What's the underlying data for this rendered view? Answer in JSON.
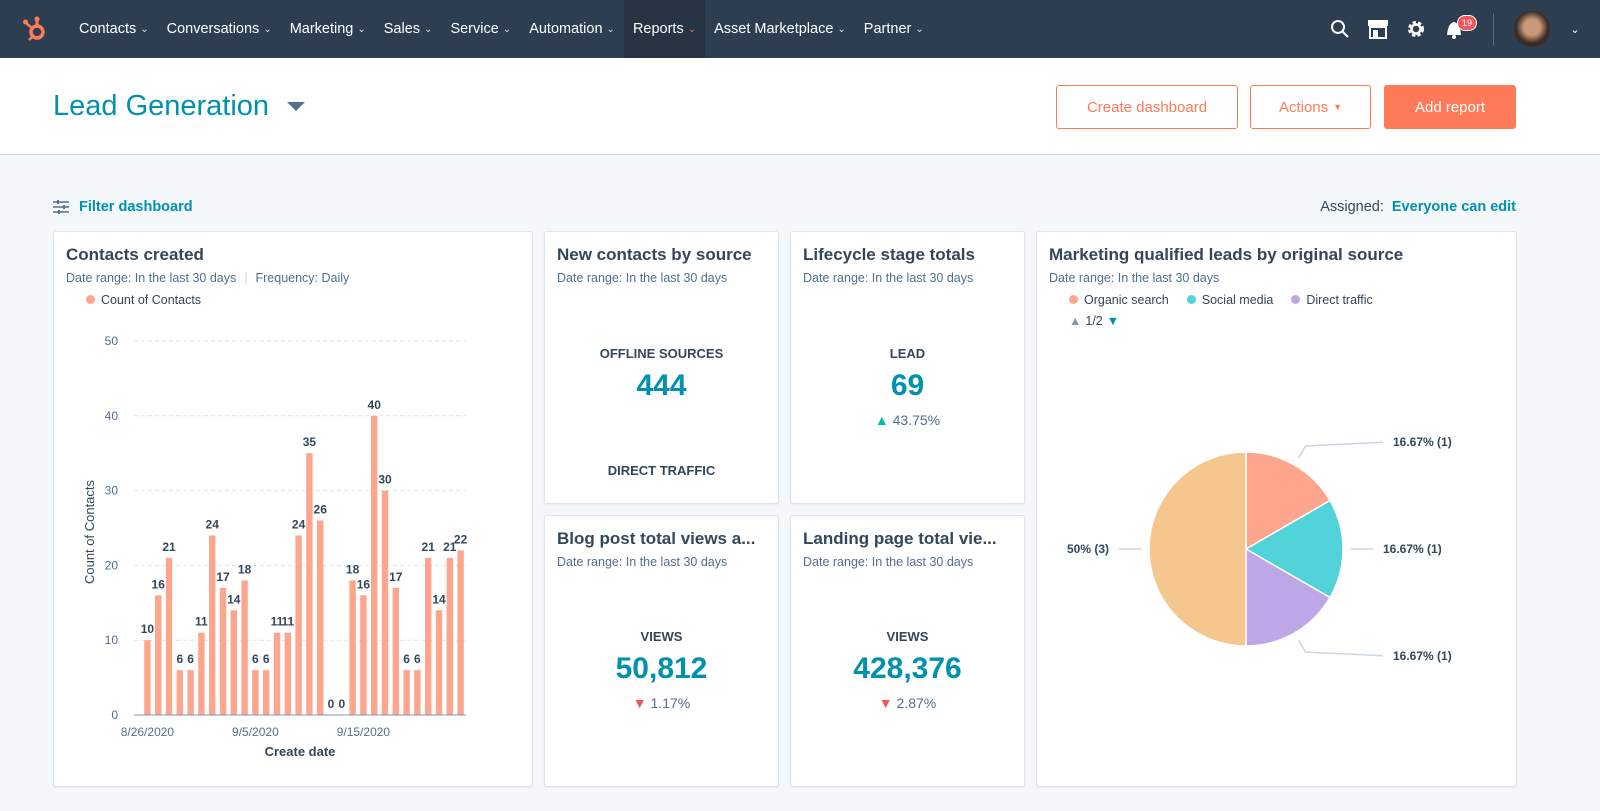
{
  "nav": {
    "items": [
      "Contacts",
      "Conversations",
      "Marketing",
      "Sales",
      "Service",
      "Automation",
      "Reports",
      "Asset Marketplace",
      "Partner"
    ],
    "active": "Reports",
    "notification_count": "19",
    "icons": [
      "search-icon",
      "marketplace-icon",
      "gear-icon",
      "bell-icon",
      "avatar"
    ]
  },
  "header": {
    "title": "Lead Generation",
    "create_dashboard": "Create dashboard",
    "actions": "Actions",
    "add_report": "Add report"
  },
  "toolbar": {
    "filter": "Filter dashboard",
    "assigned_label": "Assigned:",
    "assigned_value": "Everyone can edit"
  },
  "colors": {
    "accent": "#ff7a59",
    "teal": "#0091ae",
    "bar": "#fea58e",
    "organic": "#fea58e",
    "social": "#51d3d9",
    "direct": "#bea7e6",
    "other": "#f5c78e"
  },
  "cards": {
    "contacts": {
      "title": "Contacts created",
      "date_range": "Date range: In the last 30 days",
      "frequency": "Frequency: Daily",
      "legend": "Count of Contacts"
    },
    "new_contacts": {
      "title": "New contacts by source",
      "date_range": "Date range: In the last 30 days",
      "label1": "OFFLINE SOURCES",
      "value1": "444",
      "label2": "DIRECT TRAFFIC"
    },
    "lifecycle": {
      "title": "Lifecycle stage totals",
      "date_range": "Date range: In the last 30 days",
      "label": "LEAD",
      "value": "69",
      "change": "43.75%"
    },
    "blog": {
      "title": "Blog post total views a...",
      "date_range": "Date range: In the last 30 days",
      "label": "VIEWS",
      "value": "50,812",
      "change": "1.17%"
    },
    "landing": {
      "title": "Landing page total vie...",
      "date_range": "Date range: In the last 30 days",
      "label": "VIEWS",
      "value": "428,376",
      "change": "2.87%"
    },
    "mql": {
      "title": "Marketing qualified leads by original source",
      "date_range": "Date range: In the last 30 days",
      "pager": "1/2"
    }
  },
  "chart_data": [
    {
      "type": "bar",
      "title": "Contacts created",
      "xlabel": "Create date",
      "ylabel": "Count of Contacts",
      "ylim": [
        0,
        50
      ],
      "yticks": [
        "0",
        "10",
        "20",
        "30",
        "40",
        "50"
      ],
      "xticks": [
        "8/26/2020",
        "9/5/2020",
        "9/15/2020"
      ],
      "grid": true,
      "legend": "top-left",
      "series": [
        {
          "name": "Count of Contacts",
          "values": [
            10,
            16,
            21,
            6,
            6,
            11,
            24,
            17,
            14,
            18,
            6,
            6,
            11,
            11,
            24,
            35,
            26,
            0,
            0,
            18,
            16,
            40,
            30,
            17,
            6,
            6,
            21,
            14,
            21,
            22
          ]
        }
      ]
    },
    {
      "type": "pie",
      "title": "Marketing qualified leads by original source",
      "legend": "top-left",
      "slices": [
        {
          "name": "Organic search",
          "value": 16.67,
          "label": "16.67% (1)"
        },
        {
          "name": "Social media",
          "value": 16.67,
          "label": "16.67% (1)"
        },
        {
          "name": "Direct traffic",
          "value": 16.67,
          "label": "16.67% (1)"
        },
        {
          "name": "",
          "value": 50,
          "label": "50% (3)"
        }
      ]
    }
  ]
}
